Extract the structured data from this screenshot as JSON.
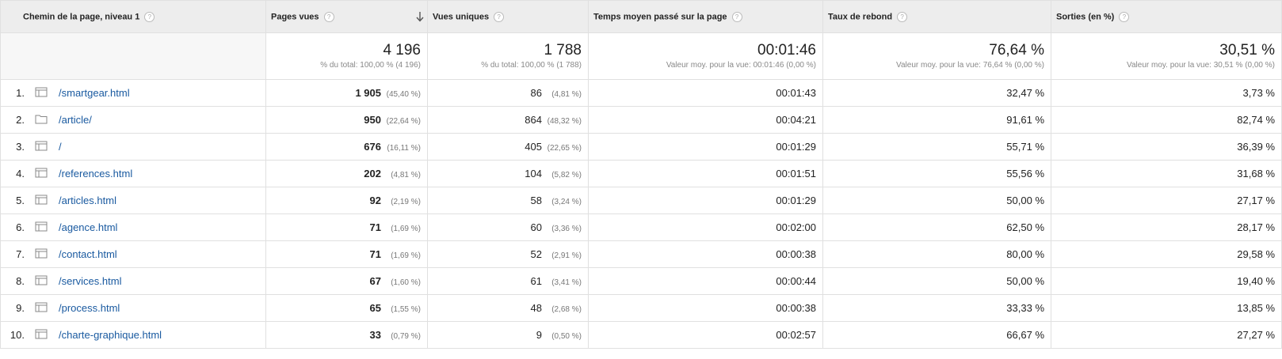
{
  "columns": [
    {
      "label": "Chemin de la page, niveau 1",
      "help": "?"
    },
    {
      "label": "Pages vues",
      "help": "?"
    },
    {
      "label": "Vues uniques",
      "help": "?"
    },
    {
      "label": "Temps moyen passé sur la page",
      "help": "?"
    },
    {
      "label": "Taux de rebond",
      "help": "?"
    },
    {
      "label": "Sorties (en %)",
      "help": "?"
    }
  ],
  "totals": {
    "pageviews": {
      "value": "4 196",
      "sub": "% du total: 100,00 % (4 196)"
    },
    "unique": {
      "value": "1 788",
      "sub": "% du total: 100,00 % (1 788)"
    },
    "avg_time": {
      "value": "00:01:46",
      "sub": "Valeur moy. pour la vue: 00:01:46 (0,00 %)"
    },
    "bounce": {
      "value": "76,64 %",
      "sub": "Valeur moy. pour la vue: 76,64 % (0,00 %)"
    },
    "exits": {
      "value": "30,51 %",
      "sub": "Valeur moy. pour la vue: 30,51 % (0,00 %)"
    }
  },
  "rows": [
    {
      "rank": "1.",
      "icon": "page-icon",
      "path": "/smartgear.html",
      "pageviews": "1 905",
      "pageviews_pct": "(45,40 %)",
      "unique": "86",
      "unique_pct": "(4,81 %)",
      "avg_time": "00:01:43",
      "bounce": "32,47 %",
      "exits": "3,73 %"
    },
    {
      "rank": "2.",
      "icon": "folder-icon",
      "path": "/article/",
      "pageviews": "950",
      "pageviews_pct": "(22,64 %)",
      "unique": "864",
      "unique_pct": "(48,32 %)",
      "avg_time": "00:04:21",
      "bounce": "91,61 %",
      "exits": "82,74 %"
    },
    {
      "rank": "3.",
      "icon": "page-icon",
      "path": "/",
      "pageviews": "676",
      "pageviews_pct": "(16,11 %)",
      "unique": "405",
      "unique_pct": "(22,65 %)",
      "avg_time": "00:01:29",
      "bounce": "55,71 %",
      "exits": "36,39 %"
    },
    {
      "rank": "4.",
      "icon": "page-icon",
      "path": "/references.html",
      "pageviews": "202",
      "pageviews_pct": "(4,81 %)",
      "unique": "104",
      "unique_pct": "(5,82 %)",
      "avg_time": "00:01:51",
      "bounce": "55,56 %",
      "exits": "31,68 %"
    },
    {
      "rank": "5.",
      "icon": "page-icon",
      "path": "/articles.html",
      "pageviews": "92",
      "pageviews_pct": "(2,19 %)",
      "unique": "58",
      "unique_pct": "(3,24 %)",
      "avg_time": "00:01:29",
      "bounce": "50,00 %",
      "exits": "27,17 %"
    },
    {
      "rank": "6.",
      "icon": "page-icon",
      "path": "/agence.html",
      "pageviews": "71",
      "pageviews_pct": "(1,69 %)",
      "unique": "60",
      "unique_pct": "(3,36 %)",
      "avg_time": "00:02:00",
      "bounce": "62,50 %",
      "exits": "28,17 %"
    },
    {
      "rank": "7.",
      "icon": "page-icon",
      "path": "/contact.html",
      "pageviews": "71",
      "pageviews_pct": "(1,69 %)",
      "unique": "52",
      "unique_pct": "(2,91 %)",
      "avg_time": "00:00:38",
      "bounce": "80,00 %",
      "exits": "29,58 %"
    },
    {
      "rank": "8.",
      "icon": "page-icon",
      "path": "/services.html",
      "pageviews": "67",
      "pageviews_pct": "(1,60 %)",
      "unique": "61",
      "unique_pct": "(3,41 %)",
      "avg_time": "00:00:44",
      "bounce": "50,00 %",
      "exits": "19,40 %"
    },
    {
      "rank": "9.",
      "icon": "page-icon",
      "path": "/process.html",
      "pageviews": "65",
      "pageviews_pct": "(1,55 %)",
      "unique": "48",
      "unique_pct": "(2,68 %)",
      "avg_time": "00:00:38",
      "bounce": "33,33 %",
      "exits": "13,85 %"
    },
    {
      "rank": "10.",
      "icon": "page-icon",
      "path": "/charte-graphique.html",
      "pageviews": "33",
      "pageviews_pct": "(0,79 %)",
      "unique": "9",
      "unique_pct": "(0,50 %)",
      "avg_time": "00:02:57",
      "bounce": "66,67 %",
      "exits": "27,27 %"
    }
  ],
  "colors": {
    "link": "#1a5aa0",
    "header_bg": "#ededed",
    "border": "#e0e0e0"
  }
}
